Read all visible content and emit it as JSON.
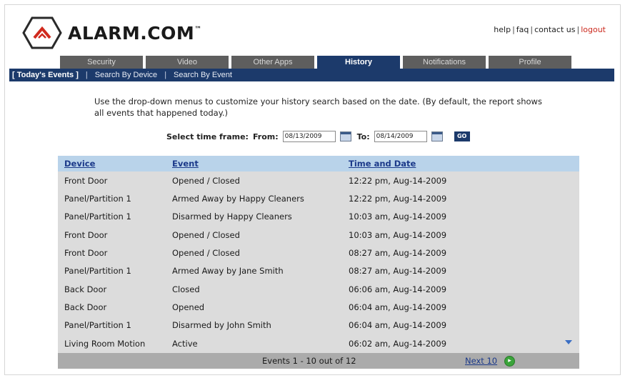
{
  "brand": {
    "name": "ALARM.COM",
    "tm": "™"
  },
  "top_links": [
    "help",
    "faq",
    "contact us",
    "logout"
  ],
  "tabs": [
    "Security",
    "Video",
    "Other Apps",
    "History",
    "Notifications",
    "Profile"
  ],
  "active_tab": "History",
  "subnav": {
    "items": [
      "[ Today's Events ]",
      "Search By Device",
      "Search By Event"
    ]
  },
  "intro": "Use the drop-down menus to customize your history search based on the date. (By default, the report shows all events that happened today.)",
  "timeframe": {
    "label": "Select time frame:",
    "from_label": "From:",
    "from_value": "08/13/2009",
    "to_label": "To:",
    "to_value": "08/14/2009",
    "go_label": "GO"
  },
  "table": {
    "headers": [
      "Device",
      "Event",
      "Time and Date"
    ],
    "rows": [
      [
        "Front Door",
        "Opened / Closed",
        "12:22 pm, Aug-14-2009"
      ],
      [
        "Panel/Partition 1",
        "Armed Away by Happy Cleaners",
        "12:22 pm, Aug-14-2009"
      ],
      [
        "Panel/Partition 1",
        "Disarmed by Happy Cleaners",
        "10:03 am, Aug-14-2009"
      ],
      [
        "Front Door",
        "Opened / Closed",
        "10:03 am, Aug-14-2009"
      ],
      [
        "Front Door",
        "Opened / Closed",
        "08:27 am, Aug-14-2009"
      ],
      [
        "Panel/Partition 1",
        "Armed Away by Jane Smith",
        "08:27 am, Aug-14-2009"
      ],
      [
        "Back Door",
        "Closed",
        "06:06 am, Aug-14-2009"
      ],
      [
        "Back Door",
        "Opened",
        "06:04 am, Aug-14-2009"
      ],
      [
        "Panel/Partition 1",
        "Disarmed by John Smith",
        "06:04 am, Aug-14-2009"
      ],
      [
        "Living Room Motion",
        "Active",
        "06:02 am, Aug-14-2009"
      ]
    ],
    "footer_count": "Events 1 - 10 out of 12",
    "next_label": "Next 10"
  },
  "colors": {
    "nav_blue": "#1c3a6b",
    "tab_gray": "#5e5e5e",
    "header_blue": "#b9d3ea",
    "logout_red": "#cc2a1e",
    "next_green": "#3aa33a"
  }
}
